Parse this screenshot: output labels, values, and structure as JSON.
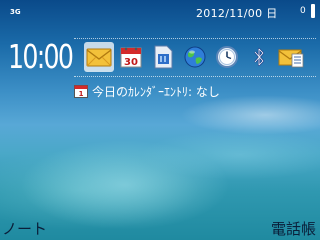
{
  "status_bar": {
    "network": "3G",
    "date": "2012/11/00 日",
    "battery_level": "0"
  },
  "clock": {
    "time": "10:00"
  },
  "shortcuts": [
    {
      "name": "messaging",
      "icon": "envelope-icon",
      "selected": true
    },
    {
      "name": "calendar",
      "icon": "calendar-icon",
      "day": "30"
    },
    {
      "name": "contacts",
      "icon": "sim-card-icon"
    },
    {
      "name": "web",
      "icon": "globe-icon"
    },
    {
      "name": "clock",
      "icon": "clock-icon"
    },
    {
      "name": "bluetooth",
      "icon": "bluetooth-icon"
    },
    {
      "name": "mail",
      "icon": "mail-list-icon"
    }
  ],
  "calendar_entry": {
    "icon": "calendar-small-icon",
    "text": "今日のｶﾚﾝﾀﾞｰｴﾝﾄﾘ: なし"
  },
  "softkeys": {
    "left": "ノート",
    "right": "電話帳"
  },
  "colors": {
    "selection_bg": "#ffffffbf",
    "softkey_text": "#0a1f3a",
    "text": "#ffffff"
  }
}
